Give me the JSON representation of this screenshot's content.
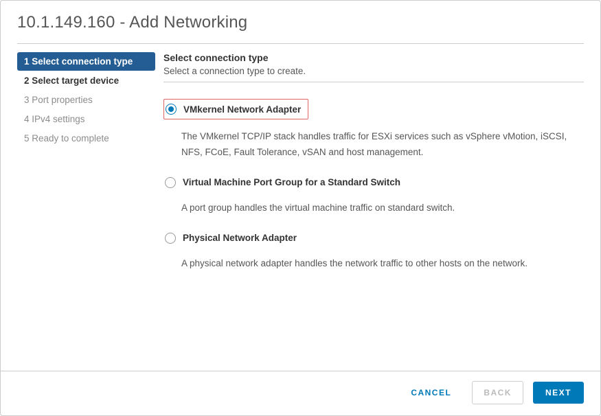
{
  "header": {
    "title": "10.1.149.160 - Add Networking"
  },
  "sidebar": {
    "steps": [
      {
        "label": "1 Select connection type"
      },
      {
        "label": "2 Select target device"
      },
      {
        "label": "3 Port properties"
      },
      {
        "label": "4 IPv4 settings"
      },
      {
        "label": "5 Ready to complete"
      }
    ]
  },
  "content": {
    "title": "Select connection type",
    "subtitle": "Select a connection type to create.",
    "options": [
      {
        "label": "VMkernel Network Adapter",
        "desc": "The VMkernel TCP/IP stack handles traffic for ESXi services such as vSphere vMotion, iSCSI, NFS, FCoE, Fault Tolerance, vSAN and host management."
      },
      {
        "label": "Virtual Machine Port Group for a Standard Switch",
        "desc": "A port group handles the virtual machine traffic on standard switch."
      },
      {
        "label": "Physical Network Adapter",
        "desc": "A physical network adapter handles the network traffic to other hosts on the network."
      }
    ]
  },
  "footer": {
    "cancel": "CANCEL",
    "back": "BACK",
    "next": "NEXT"
  }
}
